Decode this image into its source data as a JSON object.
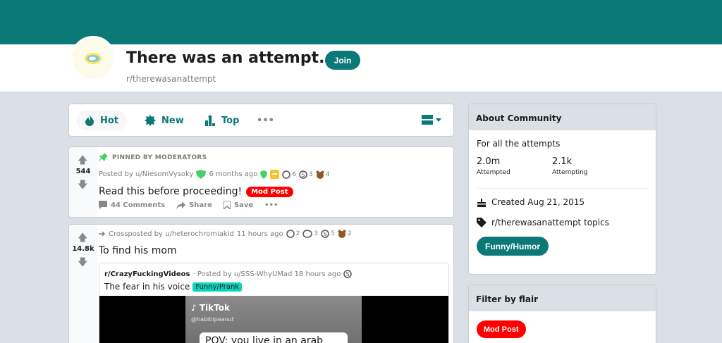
{
  "subreddit": {
    "title": "There was an attempt..",
    "name": "r/therewasanattempt",
    "join_label": "Join"
  },
  "sort": {
    "hot": "Hot",
    "new": "New",
    "top": "Top",
    "more": "•••"
  },
  "posts": [
    {
      "pinned_label": "PINNED BY MODERATORS",
      "votes": "544",
      "posted_by": "Posted by u/NiesomVysoky",
      "time": "6 months ago",
      "awards": [
        {
          "icon": "award-silver-icon",
          "count": "6"
        },
        {
          "icon": "award-s-icon",
          "count": "3"
        },
        {
          "icon": "award-bear-icon",
          "count": "4"
        }
      ],
      "title": "Read this before proceeding!",
      "flair": "Mod Post",
      "comments": "44 Comments",
      "share": "Share",
      "save": "Save",
      "more": "•••"
    },
    {
      "votes": "14.8k",
      "crossposted_by": "Crossposted by u/heterochromiakid",
      "time": "11 hours ago",
      "awards": [
        {
          "icon": "award-silver-icon",
          "count": "2"
        },
        {
          "icon": "award-hug-icon",
          "count": "3"
        },
        {
          "icon": "award-s-icon",
          "count": "5"
        },
        {
          "icon": "award-bear-icon",
          "count": "2"
        }
      ],
      "title": "To find his mom",
      "crosspost": {
        "subreddit": "r/CrazyFuckingVideos",
        "posted_by": "· Posted by u/SSS-WhyUMad 18 hours ago",
        "title": "The fear in his voice",
        "flair": "Funny/Prank",
        "video_brand": "TikTok",
        "video_user": "@habibipeanut",
        "video_caption": "POV: you live in an arab"
      }
    }
  ],
  "about": {
    "heading": "About Community",
    "description": "For all the attempts",
    "members_value": "2.0m",
    "members_label": "Attempted",
    "online_value": "2.1k",
    "online_label": "Attempting",
    "created": "Created Aug 21, 2015",
    "topics": "r/therewasanattempt topics",
    "topic_button": "Funny/Humor"
  },
  "filter": {
    "heading": "Filter by flair",
    "flair": "Mod Post"
  },
  "colors": {
    "brand": "#0b7978",
    "mod_flair": "#ff0000",
    "prank_flair": "#0dd3bb"
  }
}
